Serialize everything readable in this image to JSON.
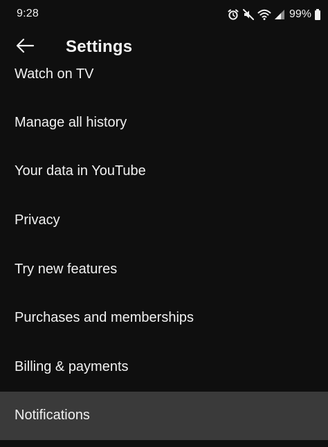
{
  "status_bar": {
    "time": "9:28",
    "battery": "99%",
    "icons": [
      "alarm-icon",
      "mute-icon",
      "wifi-icon",
      "signal-icon",
      "battery-icon"
    ]
  },
  "header": {
    "title": "Settings",
    "back_icon": "arrow-left-icon"
  },
  "settings": {
    "items": [
      {
        "label": "Watch on TV"
      },
      {
        "label": "Manage all history"
      },
      {
        "label": "Your data in YouTube"
      },
      {
        "label": "Privacy"
      },
      {
        "label": "Try new features"
      },
      {
        "label": "Purchases and memberships"
      },
      {
        "label": "Billing & payments"
      },
      {
        "label": "Notifications"
      }
    ]
  },
  "colors": {
    "background": "#0f0f0f",
    "text": "#f1f1f1",
    "highlight": "#3a3a3a"
  }
}
